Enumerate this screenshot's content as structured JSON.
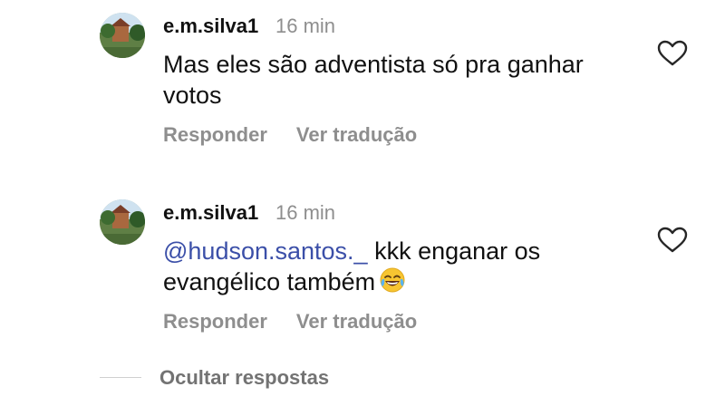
{
  "comments": [
    {
      "username": "e.m.silva1",
      "time": "16 min",
      "text": "Mas eles são adventista só pra ganhar votos",
      "reply_label": "Responder",
      "translate_label": "Ver tradução"
    },
    {
      "username": "e.m.silva1",
      "time": "16 min",
      "mention": "@hudson.santos._",
      "text": " kkk enganar os evangélico também",
      "emoji": "face-with-tears-of-joy",
      "reply_label": "Responder",
      "translate_label": "Ver tradução"
    }
  ],
  "hide_replies_label": "Ocultar respostas",
  "colors": {
    "mention": "#3b4fa8",
    "muted": "#8e8e8e",
    "text": "#111111"
  }
}
